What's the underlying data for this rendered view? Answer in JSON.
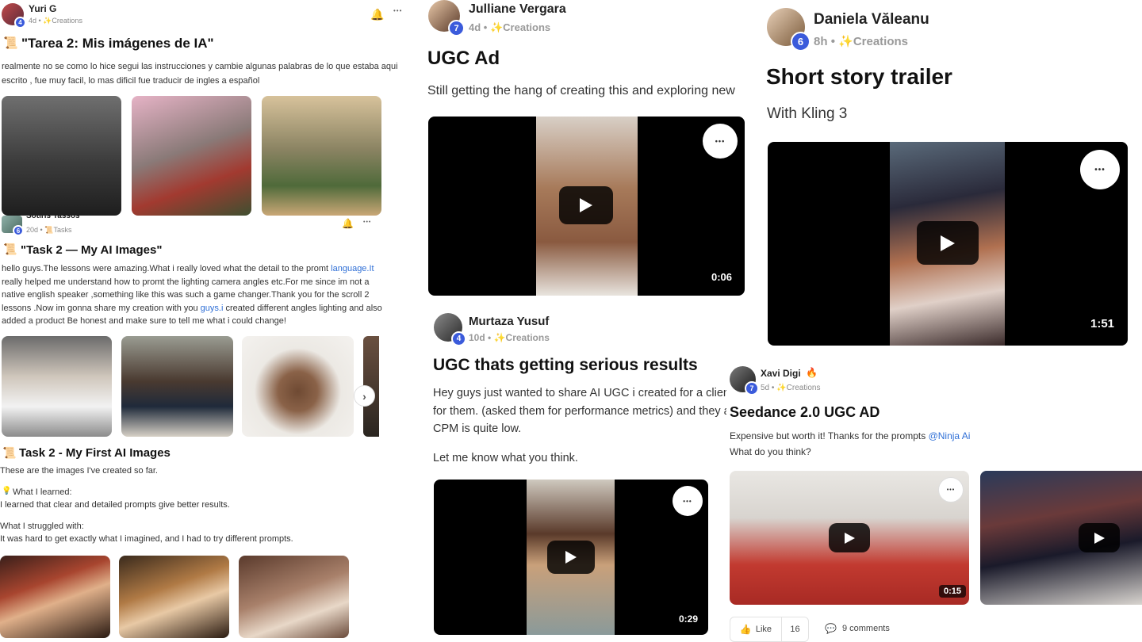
{
  "posts": [
    {
      "author": "Yuri G",
      "level": "4",
      "age": "4d",
      "category": "Creations",
      "title": "\"Tarea 2: Mis imágenes de IA\"",
      "body": "realmente no se como lo hice segui las instrucciones y cambie algunas palabras de lo que estaba aqui escrito , fue muy facil, lo mas dificil fue traducir de ingles a español"
    },
    {
      "author": "Sotiris Tassos",
      "level": "6",
      "age": "20d",
      "category": "Tasks",
      "title": "\"Task 2 — My AI Images\"",
      "body_parts": [
        "hello guys.The lessons were amazing.What i really loved what the detail to the promt ",
        "language.It",
        " really helped me understand how to promt the lighting camera angles etc.For me since im not a native english speaker ,something like this was such a game changer.Thank you for the scroll 2 lessons .Now im gonna share my creation with you ",
        "guys.i",
        " created different angles lighting and also added a product Be honest and make sure to tell me what i could change!"
      ]
    },
    {
      "title": "Task 2 - My First AI Images",
      "intro": "These are the images I've created so far.",
      "learned_label": "What I learned:",
      "learned_text": "I learned that clear and detailed prompts give better results.",
      "struggled_label": "What I struggled with:",
      "struggled_text": "It was hard to get exactly what I imagined, and I had to try different prompts."
    },
    {
      "author": "Julliane Vergara",
      "level": "7",
      "age": "4d",
      "category": "Creations",
      "title": "UGC Ad",
      "body": "Still getting the hang of creating this and exploring new",
      "duration": "0:06"
    },
    {
      "author": "Murtaza Yusuf",
      "level": "4",
      "age": "10d",
      "category": "Creations",
      "title": "UGC thats getting serious results",
      "body1": "Hey guys just wanted to share AI UGC i created for a client and it's been getting amazing results for them. (asked them for performance metrics) and they are really happy with the leads and CPM is quite low.",
      "body2": "Let me know what you think.",
      "duration": "0:29"
    },
    {
      "author": "Daniela Văleanu",
      "level": "6",
      "age": "8h",
      "category": "Creations",
      "title": "Short story trailer",
      "body": "With Kling 3",
      "duration": "1:51"
    },
    {
      "author": "Xavi Digi",
      "level": "7",
      "age": "5d",
      "category": "Creations",
      "title": "Seedance 2.0 UGC AD",
      "body_pre": "Expensive but worth it! Thanks for the prompts ",
      "mention": "@Ninja Ai",
      "body2": "What do you think?",
      "duration": "0:15",
      "like_label": "Like",
      "like_count": "16",
      "comments_label": "9 comments"
    }
  ],
  "sep": "•",
  "more_glyph": "•••",
  "icons": [
    "bell-icon",
    "more-icon",
    "play-icon",
    "chevron-right-icon",
    "sparkle-icon",
    "scroll-icon",
    "lightbulb-icon",
    "thumbs-up-icon",
    "comment-icon",
    "fire-icon"
  ],
  "colors": {
    "accent": "#2f6fd6",
    "level_badge": "#3b5bdb",
    "spark": "#f2a93b"
  }
}
